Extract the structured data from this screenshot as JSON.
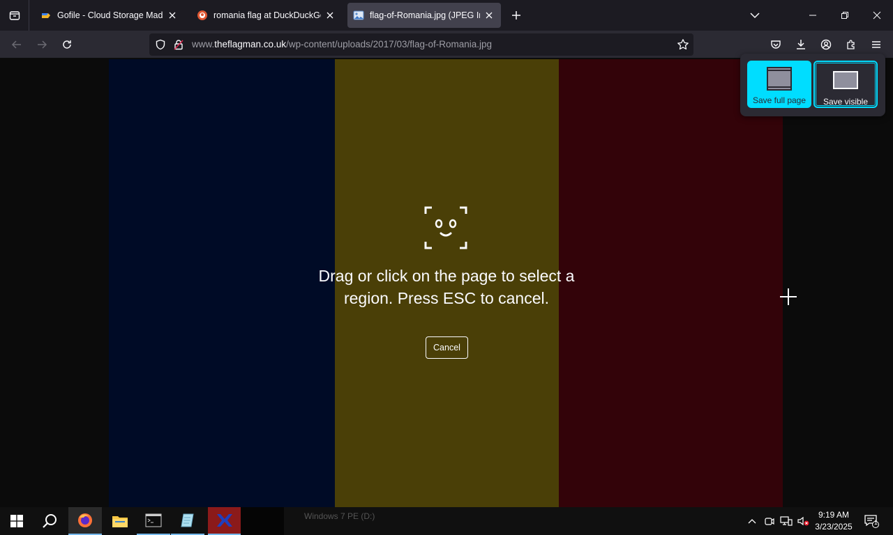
{
  "browser": {
    "tabs": [
      {
        "title": "Gofile - Cloud Storage Made Simple",
        "favicon": "gofile-icon",
        "active": false
      },
      {
        "title": "romania flag at DuckDuckGo",
        "favicon": "duckduckgo-icon",
        "active": false
      },
      {
        "title": "flag-of-Romania.jpg (JPEG Image",
        "favicon": "image-icon",
        "active": true
      }
    ],
    "url": {
      "prefix": "www.",
      "host": "theflagman.co.uk",
      "path": "/wp-content/uploads/2017/03/flag-of-Romania.jpg"
    }
  },
  "page": {
    "flag_colors": {
      "blue": "#000b26",
      "yellow": "#4a3f07",
      "red": "#330309"
    }
  },
  "screenshot_overlay": {
    "message": "Drag or click on the page to select a region. Press ESC to cancel.",
    "cancel_label": "Cancel",
    "save_full_page_label": "Save full page",
    "save_visible_label": "Save visible",
    "accent": "#00ddff"
  },
  "taskbar": {
    "hidden_window_label": "Windows 7 PE (D:)",
    "time": "9:19 AM",
    "date": "3/23/2025",
    "notification_count": "1"
  }
}
